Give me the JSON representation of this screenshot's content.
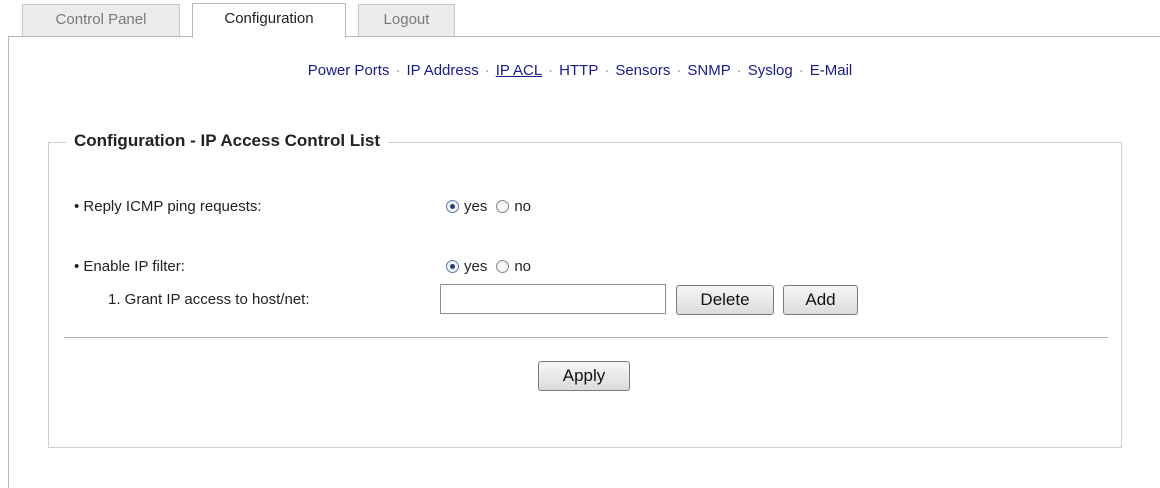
{
  "tabs": [
    {
      "label": "Control Panel",
      "active": false
    },
    {
      "label": "Configuration",
      "active": true
    },
    {
      "label": "Logout",
      "active": false
    }
  ],
  "subnav": {
    "items": [
      "Power Ports",
      "IP Address",
      "IP ACL",
      "HTTP",
      "Sensors",
      "SNMP",
      "Syslog",
      "E-Mail"
    ],
    "current": "IP ACL",
    "separator": "·"
  },
  "panel": {
    "title": "Configuration - IP Access Control List",
    "icmp": {
      "label": "• Reply ICMP ping requests:",
      "yes_label": "yes",
      "no_label": "no",
      "selected": "yes"
    },
    "ipfilter": {
      "label": "• Enable IP filter:",
      "yes_label": "yes",
      "no_label": "no",
      "selected": "yes"
    },
    "grant": {
      "label": "1. Grant IP access to host/net:",
      "value": ""
    },
    "delete_label": "Delete",
    "add_label": "Add",
    "apply_label": "Apply"
  }
}
